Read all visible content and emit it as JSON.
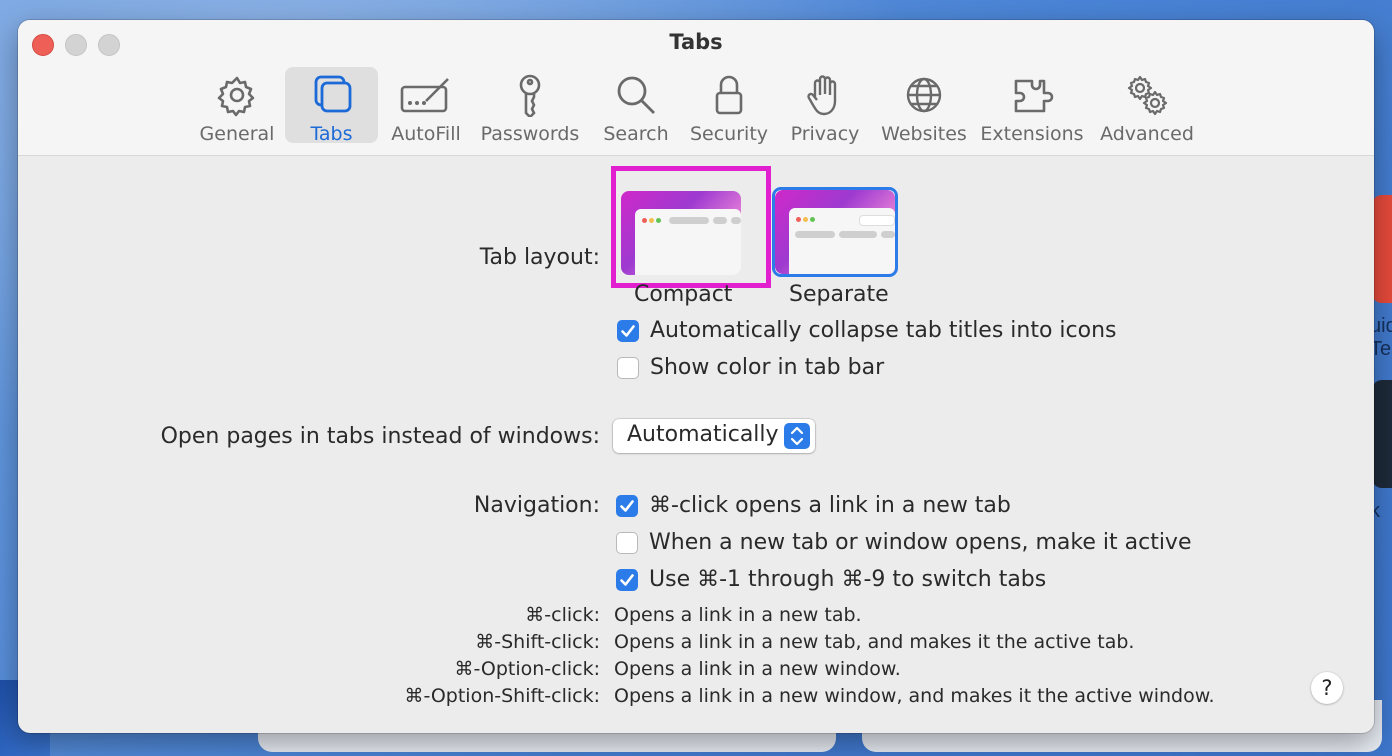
{
  "window": {
    "title": "Tabs"
  },
  "toolbar": {
    "items": [
      {
        "label": "General",
        "icon": "gear-icon"
      },
      {
        "label": "Tabs",
        "icon": "tabs-icon"
      },
      {
        "label": "AutoFill",
        "icon": "autofill-pen-icon"
      },
      {
        "label": "Passwords",
        "icon": "key-icon"
      },
      {
        "label": "Search",
        "icon": "magnifier-icon"
      },
      {
        "label": "Security",
        "icon": "lock-icon"
      },
      {
        "label": "Privacy",
        "icon": "hand-icon"
      },
      {
        "label": "Websites",
        "icon": "globe-icon"
      },
      {
        "label": "Extensions",
        "icon": "puzzle-icon"
      },
      {
        "label": "Advanced",
        "icon": "gears-icon"
      }
    ],
    "active": "Tabs"
  },
  "tab_layout": {
    "label": "Tab layout:",
    "options": [
      {
        "label": "Compact",
        "selected": true
      },
      {
        "label": "Separate",
        "selected": false
      }
    ]
  },
  "layout_checkboxes": [
    {
      "label": "Automatically collapse tab titles into icons",
      "checked": true
    },
    {
      "label": "Show color in tab bar",
      "checked": false
    }
  ],
  "open_pages": {
    "label": "Open pages in tabs instead of windows:",
    "value": "Automatically"
  },
  "navigation": {
    "label": "Navigation:",
    "options": [
      {
        "label": "⌘-click opens a link in a new tab",
        "checked": true
      },
      {
        "label": "When a new tab or window opens, make it active",
        "checked": false
      },
      {
        "label": "Use ⌘-1 through ⌘-9 to switch tabs",
        "checked": true
      }
    ]
  },
  "shortcuts": [
    {
      "key": "⌘-click:",
      "desc": "Opens a link in a new tab."
    },
    {
      "key": "⌘-Shift-click:",
      "desc": "Opens a link in a new tab, and makes it the active tab."
    },
    {
      "key": "⌘-Option-click:",
      "desc": "Opens a link in a new window."
    },
    {
      "key": "⌘-Option-Shift-click:",
      "desc": "Opens a link in a new window, and makes it the active window."
    }
  ],
  "help": {
    "label": "?"
  },
  "background": {
    "text1": "uid",
    "text2": "Tec",
    "text3": "k"
  },
  "colors": {
    "accent": "#2b7be8",
    "highlight": "#e21fcf",
    "close": "#ed5f57"
  }
}
